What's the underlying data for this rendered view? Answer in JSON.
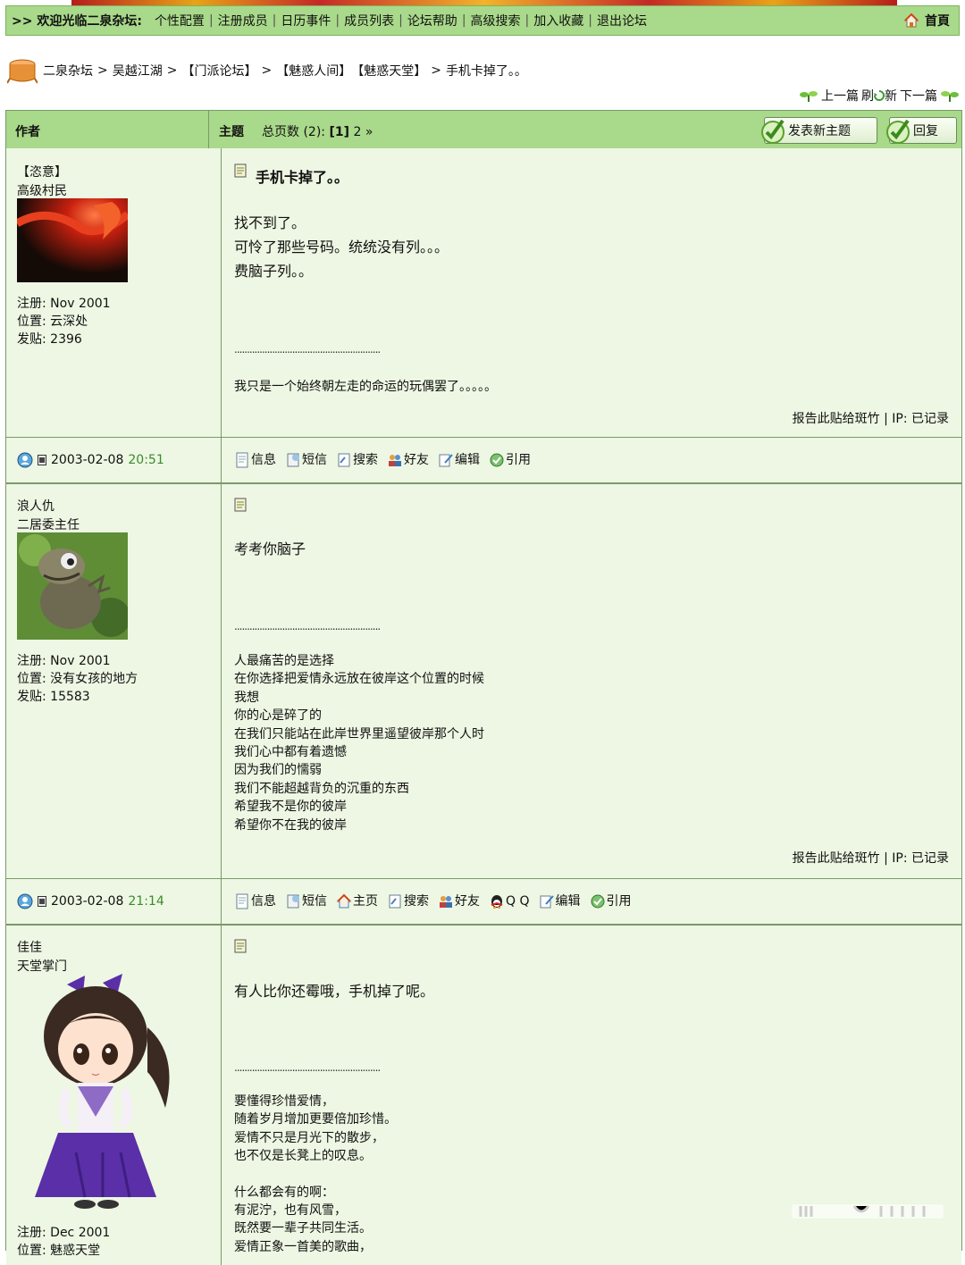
{
  "topnav": {
    "welcome": ">> 欢迎光临二泉杂坛:",
    "links": [
      "个性配置",
      "注册成员",
      "日历事件",
      "成员列表",
      "论坛帮助",
      "高级搜索",
      "加入收藏",
      "退出论坛"
    ],
    "home": "首頁"
  },
  "breadcrumb": {
    "items": [
      "二泉杂坛",
      "吴越江湖",
      "【门派论坛】",
      "【魅惑人间】",
      "【魅惑天堂】",
      "手机卡掉了。。"
    ]
  },
  "pagenav": {
    "prev": "上一篇",
    "refresh_a": "刷",
    "refresh_b": "新",
    "next": "下一篇"
  },
  "header": {
    "author": "作者",
    "subject": "主题",
    "pages_prefix": "总页数 (2): ",
    "current_page": "[1]",
    "next_page": "2",
    "next_arrow": "»",
    "new_topic": "发表新主题",
    "reply": "回复"
  },
  "posts": [
    {
      "name": "【恣意】",
      "title": "高级村民",
      "reg": "注册: Nov 2001",
      "loc": "位置: 云深处",
      "count": "发贴: 2396",
      "subject": "手机卡掉了。。",
      "body": [
        "找不到了。",
        "可怜了那些号码。统统没有列。。。",
        "费脑子列。。"
      ],
      "dots": "..........................................................",
      "sig": [
        "我只是一个始终朝左走的命运的玩偶罢了。。。。。"
      ],
      "report": "报告此贴给斑竹 | IP: 已记录",
      "date": "2003-02-08",
      "time": "20:51",
      "actions": [
        "信息",
        "短信",
        "搜索",
        "好友",
        "编辑",
        "引用"
      ]
    },
    {
      "name": "浪人仇",
      "title": "二居委主任",
      "reg": "注册: Nov 2001",
      "loc": "位置: 没有女孩的地方",
      "count": "发贴: 15583",
      "subject": "",
      "body": [
        "考考你脑子"
      ],
      "dots": "..........................................................",
      "sig": [
        "人最痛苦的是选择",
        "在你选择把爱情永远放在彼岸这个位置的时候",
        "我想",
        "你的心是碎了的",
        "在我们只能站在此岸世界里遥望彼岸那个人时",
        "我们心中都有着遗憾",
        "因为我们的懦弱",
        "我们不能超越背负的沉重的东西",
        "希望我不是你的彼岸",
        "希望你不在我的彼岸"
      ],
      "report": "报告此贴给斑竹 | IP: 已记录",
      "date": "2003-02-08",
      "time": "21:14",
      "actions": [
        "信息",
        "短信",
        "主页",
        "搜索",
        "好友",
        "Q Q",
        "编辑",
        "引用"
      ]
    },
    {
      "name": "佳佳",
      "title": "天堂掌门",
      "reg": "注册: Dec 2001",
      "loc": "位置: 魅惑天堂",
      "subject": "",
      "body": [
        "有人比你还霉哦，手机掉了呢。"
      ],
      "dots": "..........................................................",
      "sig": [
        "要懂得珍惜爱情，",
        "随着岁月增加更要倍加珍惜。",
        "爱情不只是月光下的散步，",
        "也不仅是长凳上的叹息。",
        "",
        "什么都会有的啊：",
        "有泥泞，也有风雪，",
        "既然要一辈子共同生活。",
        "爱情正象一首美的歌曲，"
      ]
    }
  ],
  "colors": {
    "nav_green": "#a9d98a",
    "post_bg": "#edf7e3",
    "time_green": "#3b8a2e",
    "border": "#7a9a6a"
  }
}
